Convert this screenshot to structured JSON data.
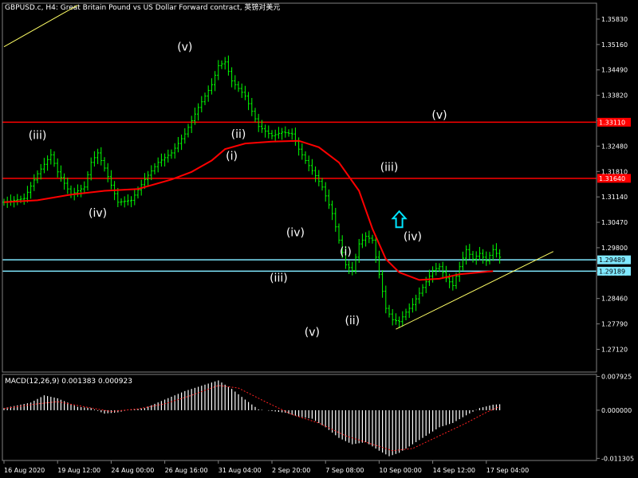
{
  "chart_data": {
    "type": "candlestick",
    "title": "GBPUSD.c, H4:  Great Britain Pound vs US Dollar Forward contract, 英镑对美元",
    "colors": {
      "background": "#000000",
      "bars": "#00ff00",
      "ma": "#ff0000",
      "horizontal_red": "#ff0000",
      "horizontal_cyan": "#7fe8ff",
      "trendline": "#ffff66",
      "macd_hist": "#ffffff",
      "macd_signal": "#ff2020",
      "arrow": "#00e5ff"
    },
    "price_axis": {
      "ylim": [
        1.2652,
        1.3625
      ],
      "ticks": [
        "1.35830",
        "1.35160",
        "1.34490",
        "1.33820",
        "1.33150",
        "1.32480",
        "1.31810",
        "1.31140",
        "1.30470",
        "1.29800",
        "1.29130",
        "1.28460",
        "1.27790",
        "1.27120"
      ],
      "tick_values": [
        1.3583,
        1.3516,
        1.3449,
        1.3382,
        1.3315,
        1.3248,
        1.3181,
        1.3114,
        1.3047,
        1.298,
        1.2913,
        1.2846,
        1.2779,
        1.2712
      ]
    },
    "time_axis": {
      "labels": [
        "16 Aug 2020",
        "19 Aug 12:00",
        "24 Aug 00:00",
        "26 Aug 16:00",
        "31 Aug 04:00",
        "2 Sep 20:00",
        "7 Sep 08:00",
        "10 Sep 00:00",
        "14 Sep 12:00",
        "17 Sep 04:00"
      ],
      "label_index": [
        0,
        16,
        32,
        48,
        64,
        80,
        96,
        112,
        128,
        144
      ]
    },
    "price_path": [
      [
        0,
        1.31
      ],
      [
        6,
        1.311
      ],
      [
        10,
        1.3175
      ],
      [
        14,
        1.3225
      ],
      [
        16,
        1.318
      ],
      [
        18,
        1.315
      ],
      [
        20,
        1.312
      ],
      [
        24,
        1.314
      ],
      [
        26,
        1.3205
      ],
      [
        28,
        1.323
      ],
      [
        30,
        1.319
      ],
      [
        34,
        1.31
      ],
      [
        38,
        1.3105
      ],
      [
        42,
        1.316
      ],
      [
        46,
        1.3205
      ],
      [
        50,
        1.323
      ],
      [
        54,
        1.328
      ],
      [
        58,
        1.335
      ],
      [
        62,
        1.341
      ],
      [
        64,
        1.346
      ],
      [
        66,
        1.347
      ],
      [
        68,
        1.342
      ],
      [
        72,
        1.338
      ],
      [
        76,
        1.33
      ],
      [
        80,
        1.3275
      ],
      [
        83,
        1.3285
      ],
      [
        86,
        1.328
      ],
      [
        88,
        1.324
      ],
      [
        90,
        1.321
      ],
      [
        93,
        1.317
      ],
      [
        95,
        1.314
      ],
      [
        98,
        1.307
      ],
      [
        100,
        1.3
      ],
      [
        102,
        1.2935
      ],
      [
        104,
        1.292
      ],
      [
        106,
        1.299
      ],
      [
        108,
        1.301
      ],
      [
        110,
        1.3
      ],
      [
        112,
        1.291
      ],
      [
        114,
        1.282
      ],
      [
        116,
        1.279
      ],
      [
        118,
        1.2785
      ],
      [
        120,
        1.281
      ],
      [
        122,
        1.283
      ],
      [
        124,
        1.286
      ],
      [
        126,
        1.289
      ],
      [
        128,
        1.292
      ],
      [
        130,
        1.293
      ],
      [
        132,
        1.29
      ],
      [
        134,
        1.288
      ],
      [
        136,
        1.293
      ],
      [
        138,
        1.2975
      ],
      [
        140,
        1.295
      ],
      [
        142,
        1.2965
      ],
      [
        144,
        1.2945
      ],
      [
        146,
        1.2975
      ],
      [
        148,
        1.2955
      ]
    ],
    "moving_average": [
      [
        0,
        1.31
      ],
      [
        10,
        1.3105
      ],
      [
        20,
        1.312
      ],
      [
        30,
        1.313
      ],
      [
        40,
        1.3135
      ],
      [
        50,
        1.316
      ],
      [
        56,
        1.318
      ],
      [
        62,
        1.321
      ],
      [
        66,
        1.324
      ],
      [
        72,
        1.3255
      ],
      [
        80,
        1.326
      ],
      [
        88,
        1.3262
      ],
      [
        94,
        1.3245
      ],
      [
        100,
        1.3205
      ],
      [
        106,
        1.313
      ],
      [
        110,
        1.303
      ],
      [
        114,
        1.295
      ],
      [
        118,
        1.2915
      ],
      [
        124,
        1.2895
      ],
      [
        130,
        1.2898
      ],
      [
        136,
        1.291
      ],
      [
        142,
        1.2915
      ],
      [
        146,
        1.2918
      ]
    ],
    "levels": [
      {
        "value": 1.3311,
        "label": "1.33110",
        "color": "#ff0000"
      },
      {
        "value": 1.3163,
        "label": "1.31640",
        "color": "#ff0000"
      },
      {
        "value": 1.2948,
        "label": "1.29489",
        "color": "#7fe8ff"
      },
      {
        "value": 1.2918,
        "label": "1.29189",
        "color": "#7fe8ff"
      }
    ],
    "trendlines": [
      {
        "from": [
          0,
          1.351
        ],
        "to": [
          22,
          1.362
        ]
      },
      {
        "from": [
          117,
          1.2765
        ],
        "to": [
          164,
          1.297
        ]
      }
    ],
    "wave_labels": [
      {
        "text": "(iii)",
        "x": 10,
        "y": 1.3267
      },
      {
        "text": "(iv)",
        "x": 28,
        "y": 1.3062
      },
      {
        "text": "(v)",
        "x": 54,
        "y": 1.35
      },
      {
        "text": "(ii)",
        "x": 70,
        "y": 1.327
      },
      {
        "text": "(i)",
        "x": 68,
        "y": 1.3212
      },
      {
        "text": "(iii)",
        "x": 82,
        "y": 1.289
      },
      {
        "text": "(iv)",
        "x": 87,
        "y": 1.301
      },
      {
        "text": "(v)",
        "x": 92,
        "y": 1.2748
      },
      {
        "text": "(i)",
        "x": 102,
        "y": 1.296
      },
      {
        "text": "(ii)",
        "x": 104,
        "y": 1.2778
      },
      {
        "text": "(iii)",
        "x": 115,
        "y": 1.3183
      },
      {
        "text": "(iv)",
        "x": 122,
        "y": 1.3
      },
      {
        "text": "(v)",
        "x": 130,
        "y": 1.332
      }
    ],
    "arrow": {
      "x": 118,
      "y": 1.3055,
      "direction": "up"
    },
    "macd": {
      "label": "MACD(12,26,9) 0.001383 0.000923",
      "ylim": [
        -0.0118,
        0.0084
      ],
      "ticks": [
        "0.007925",
        "0.000000",
        "-0.011305"
      ],
      "tick_values": [
        0.007925,
        0.0,
        -0.011305
      ],
      "histogram": [
        [
          0,
          0.0005
        ],
        [
          8,
          0.0018
        ],
        [
          12,
          0.0035
        ],
        [
          16,
          0.0028
        ],
        [
          22,
          0.0008
        ],
        [
          26,
          0.0005
        ],
        [
          30,
          -0.0008
        ],
        [
          34,
          -0.0005
        ],
        [
          38,
          0.0002
        ],
        [
          42,
          0.0005
        ],
        [
          48,
          0.0025
        ],
        [
          54,
          0.0045
        ],
        [
          60,
          0.006
        ],
        [
          64,
          0.007
        ],
        [
          68,
          0.005
        ],
        [
          72,
          0.0025
        ],
        [
          76,
          0.0002
        ],
        [
          80,
          -0.0002
        ],
        [
          84,
          -0.0006
        ],
        [
          88,
          -0.0015
        ],
        [
          92,
          -0.002
        ],
        [
          96,
          -0.004
        ],
        [
          100,
          -0.0065
        ],
        [
          104,
          -0.008
        ],
        [
          108,
          -0.0075
        ],
        [
          112,
          -0.0095
        ],
        [
          115,
          -0.0108
        ],
        [
          118,
          -0.01
        ],
        [
          122,
          -0.008
        ],
        [
          126,
          -0.006
        ],
        [
          130,
          -0.004
        ],
        [
          134,
          -0.003
        ],
        [
          138,
          -0.0012
        ],
        [
          142,
          0.0005
        ],
        [
          146,
          0.0013
        ],
        [
          148,
          0.0014
        ]
      ],
      "signal": [
        [
          0,
          0.0004
        ],
        [
          10,
          0.0015
        ],
        [
          16,
          0.002
        ],
        [
          24,
          0.0008
        ],
        [
          32,
          -0.0003
        ],
        [
          40,
          0.0003
        ],
        [
          48,
          0.0015
        ],
        [
          56,
          0.0035
        ],
        [
          64,
          0.0058
        ],
        [
          70,
          0.0052
        ],
        [
          78,
          0.002
        ],
        [
          86,
          -0.001
        ],
        [
          94,
          -0.003
        ],
        [
          102,
          -0.006
        ],
        [
          110,
          -0.008
        ],
        [
          116,
          -0.0095
        ],
        [
          122,
          -0.009
        ],
        [
          130,
          -0.006
        ],
        [
          138,
          -0.003
        ],
        [
          144,
          -0.0005
        ],
        [
          148,
          0.0009
        ]
      ]
    }
  }
}
